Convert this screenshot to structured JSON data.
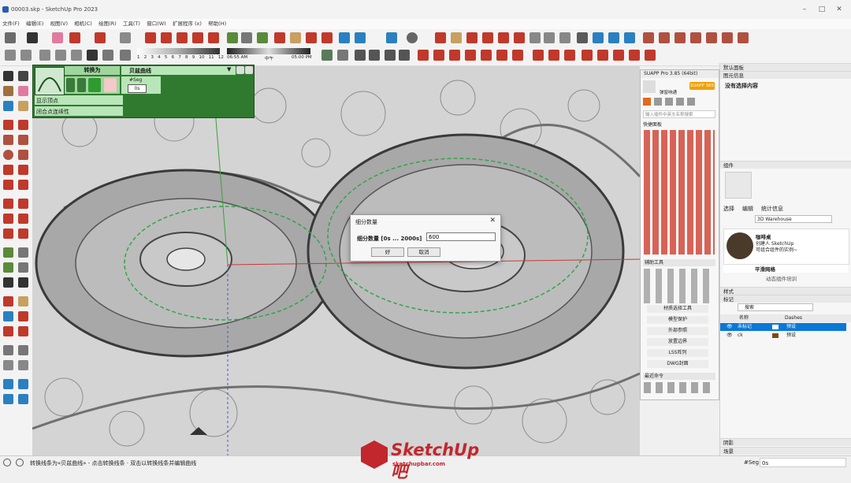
{
  "window": {
    "title": "00003.skp - SketchUp Pro 2023"
  },
  "menu": [
    "文件(F)",
    "编辑(E)",
    "视图(V)",
    "相机(C)",
    "绘图(R)",
    "工具(T)",
    "窗口(W)",
    "扩展程序 (x)",
    "帮助(H)"
  ],
  "toolbar": {
    "ruler_ticks": [
      "1",
      "2",
      "3",
      "4",
      "5",
      "6",
      "7",
      "8",
      "9",
      "10",
      "11",
      "12"
    ],
    "time_start": "06:55 AM",
    "time_mid": "中午",
    "time_end": "05:00 PM"
  },
  "convert_panel": {
    "title": "转换为",
    "curve_type": "贝兹曲线",
    "seg_label": "#Seg",
    "seg_value": "0s",
    "show_vertices": "显示顶点",
    "closed_continuity": "闭合点连续性"
  },
  "suapp": {
    "title": "SUAPP Pro 3.85 (64bit)",
    "badge": "SUAPP 365",
    "user_label": "弹窗响通",
    "search_placeholder": "输入插件中英文名称搜索",
    "quick_menu": "快捷面板",
    "aux_title": "辅助工具",
    "categories": [
      "材质选择工具",
      "模型保护",
      "外部参照",
      "放置边界",
      "LSS阵列",
      "DWG封面"
    ],
    "recent": "最近命令"
  },
  "tray": {
    "title": "默认面板",
    "entity_info": "图元信息",
    "no_selection": "没有选择内容",
    "components": "组件",
    "tabs": [
      "选择",
      "编辑",
      "统计信息"
    ],
    "warehouse_search": "3D Warehouse",
    "component1_name": "咖啡桌",
    "component1_desc1": "创建人 SketchUp",
    "component1_desc2": "可组合组件的实例~",
    "component2_name": "平滑网格",
    "dynamic_attr": "动态组件培训",
    "styles": "样式",
    "tags": "标记",
    "tag_search": "搜索",
    "tag_columns": [
      "名称",
      "Dashes"
    ],
    "tag_rows": [
      {
        "name": "未标记",
        "dash": "预设",
        "color": "#ffffff",
        "selected": true
      },
      {
        "name": "ck",
        "dash": "预设",
        "color": "#7a4a1c",
        "selected": false
      }
    ],
    "shadows": "阴影",
    "scenes": "场景"
  },
  "dialog": {
    "title": "细分数量",
    "label": "细分数量  [0s ... 2000s]",
    "value": "600",
    "ok": "好",
    "cancel": "取消"
  },
  "statusbar": {
    "message": "转换线条为«贝兹曲线» - 点击转换线条 · 双击以转换线条并编辑曲线",
    "seg_label": "#Seg",
    "seg_value": "0s"
  },
  "watermark": {
    "brand": "SketchUp吧",
    "url": "sketchupbar.com"
  },
  "colors": {
    "panel_green": "#2f7a2f",
    "selection_blue": "#0a78d7",
    "brand_red": "#c1272d"
  }
}
